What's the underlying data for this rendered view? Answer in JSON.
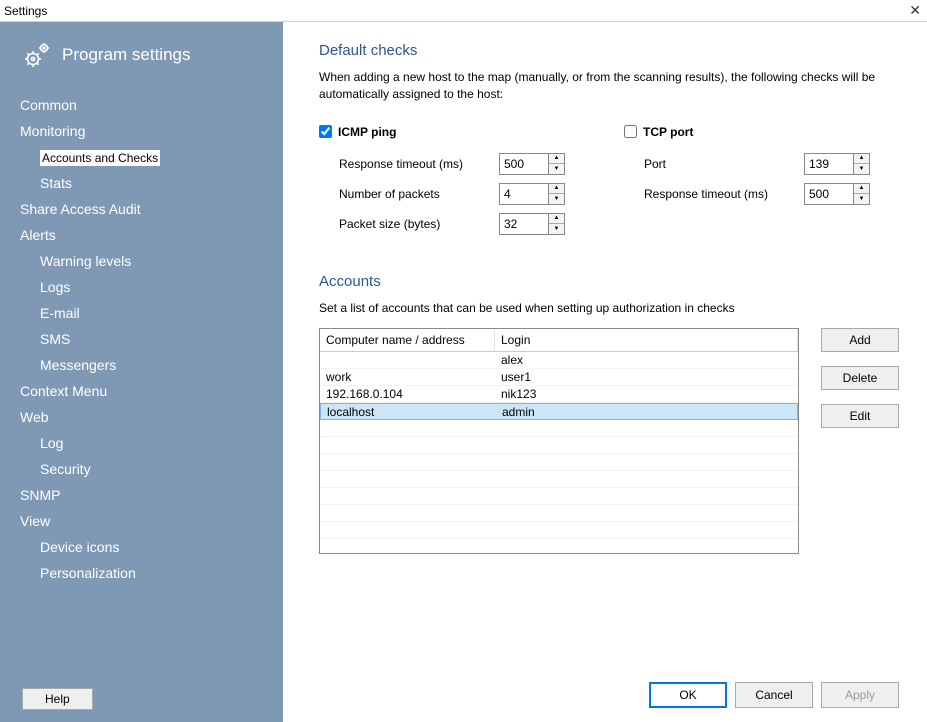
{
  "window": {
    "title": "Settings"
  },
  "sidebar": {
    "title": "Program settings",
    "items": [
      {
        "label": "Common",
        "sub": false
      },
      {
        "label": "Monitoring",
        "sub": false
      },
      {
        "label": "Accounts and Checks",
        "sub": true,
        "selected": true
      },
      {
        "label": "Stats",
        "sub": true
      },
      {
        "label": "Share Access Audit",
        "sub": false
      },
      {
        "label": "Alerts",
        "sub": false
      },
      {
        "label": "Warning levels",
        "sub": true
      },
      {
        "label": "Logs",
        "sub": true
      },
      {
        "label": "E-mail",
        "sub": true
      },
      {
        "label": "SMS",
        "sub": true
      },
      {
        "label": "Messengers",
        "sub": true
      },
      {
        "label": "Context Menu",
        "sub": false
      },
      {
        "label": "Web",
        "sub": false
      },
      {
        "label": "Log",
        "sub": true
      },
      {
        "label": "Security",
        "sub": true
      },
      {
        "label": "SNMP",
        "sub": false
      },
      {
        "label": "View",
        "sub": false
      },
      {
        "label": "Device icons",
        "sub": true
      },
      {
        "label": "Personalization",
        "sub": true
      }
    ],
    "help": "Help"
  },
  "default_checks": {
    "title": "Default checks",
    "desc": "When adding a new host to the map (manually, or from the scanning results), the following checks will be automatically assigned to the host:",
    "icmp": {
      "label": "ICMP ping",
      "checked": true,
      "timeout_label": "Response timeout (ms)",
      "timeout_value": "500",
      "packets_label": "Number of packets",
      "packets_value": "4",
      "size_label": "Packet size (bytes)",
      "size_value": "32"
    },
    "tcp": {
      "label": "TCP port",
      "checked": false,
      "port_label": "Port",
      "port_value": "139",
      "timeout_label": "Response timeout (ms)",
      "timeout_value": "500"
    }
  },
  "accounts": {
    "title": "Accounts",
    "desc": "Set a list of accounts that can be used when setting up authorization in checks",
    "headers": {
      "name": "Computer name / address",
      "login": "Login"
    },
    "rows": [
      {
        "name": "",
        "login": "alex"
      },
      {
        "name": "work",
        "login": "user1"
      },
      {
        "name": "192.168.0.104",
        "login": "nik123"
      },
      {
        "name": "localhost",
        "login": "admin",
        "selected": true
      }
    ],
    "buttons": {
      "add": "Add",
      "delete": "Delete",
      "edit": "Edit"
    }
  },
  "footer": {
    "ok": "OK",
    "cancel": "Cancel",
    "apply": "Apply"
  }
}
